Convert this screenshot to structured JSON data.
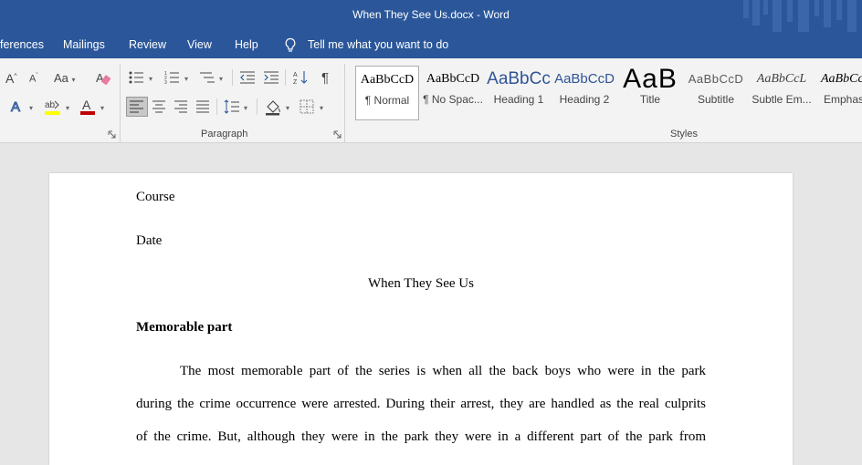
{
  "window": {
    "title": "When They See Us.docx  -  Word"
  },
  "menu": {
    "items": [
      "ferences",
      "Mailings",
      "Review",
      "View",
      "Help"
    ],
    "tell_me": "Tell me what you want to do"
  },
  "ribbon": {
    "font_buttons": {
      "grow": "A",
      "shrink": "A",
      "change_case": "Aa"
    },
    "paragraph_label": "Paragraph",
    "styles_label": "Styles",
    "styles": [
      {
        "preview": "AaBbCcD",
        "label": "¶ Normal"
      },
      {
        "preview": "AaBbCcD",
        "label": "¶ No Spac..."
      },
      {
        "preview": "AaBbCc",
        "label": "Heading 1"
      },
      {
        "preview": "AaBbCcD",
        "label": "Heading 2"
      },
      {
        "preview": "AaB",
        "label": "Title"
      },
      {
        "preview": "AaBbCcD",
        "label": "Subtitle"
      },
      {
        "preview": "AaBbCcL",
        "label": "Subtle Em..."
      },
      {
        "preview": "AaBbCcL",
        "label": "Emphasis"
      }
    ],
    "colors": {
      "highlight": "#ffff00",
      "font_color": "#c00000"
    }
  },
  "document": {
    "line1": "Course",
    "line2": "Date",
    "title": "When They See Us",
    "heading": "Memorable part",
    "para_lines": [
      "The most memorable part of the series is when all the back boys who were in the park",
      "during the crime occurrence were arrested. During their arrest, they are handled as the real culprits",
      "of the crime. But, although they were in the park they were in a different part of the park from"
    ]
  }
}
